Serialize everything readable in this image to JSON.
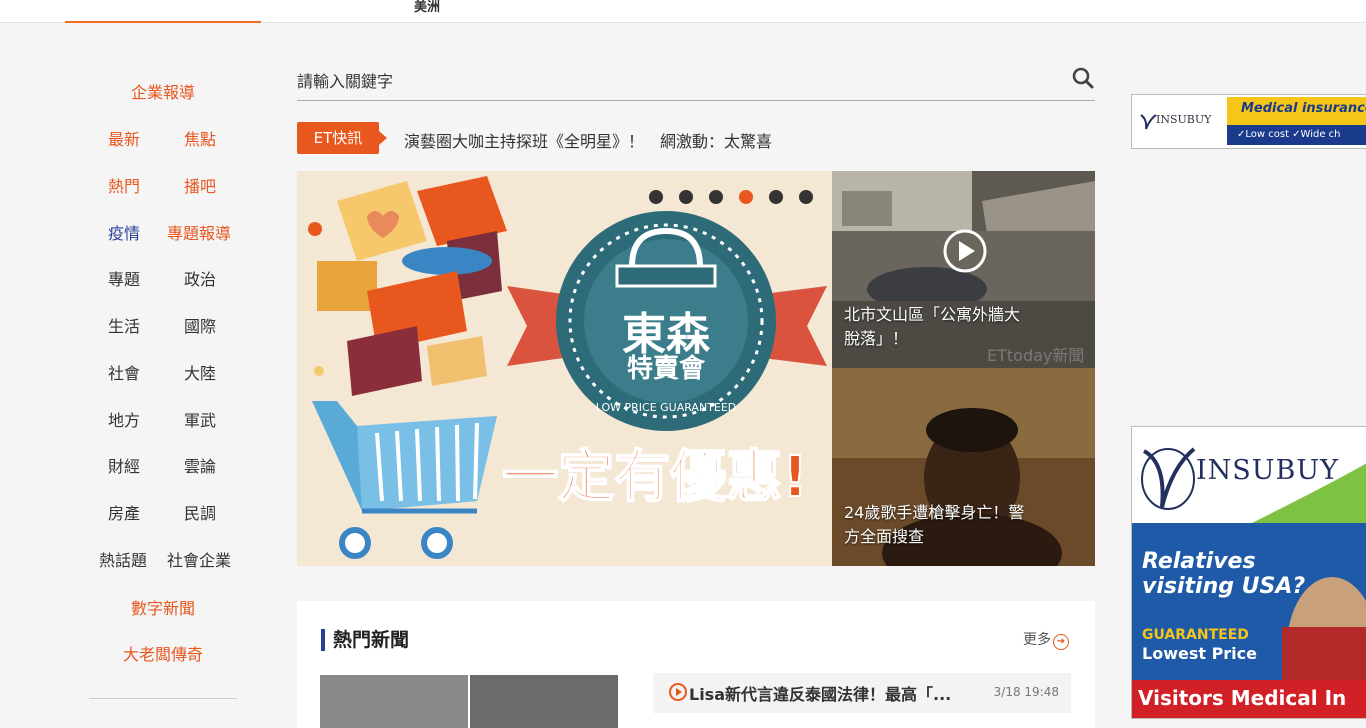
{
  "topbar": {
    "region": "美洲"
  },
  "sidebar": {
    "enterprise": "企業報導",
    "rows": [
      [
        "最新",
        "焦點"
      ],
      [
        "熱門",
        "播吧"
      ],
      [
        "疫情",
        "專題報導"
      ],
      [
        "專題",
        "政治"
      ],
      [
        "生活",
        "國際"
      ],
      [
        "社會",
        "大陸"
      ],
      [
        "地方",
        "軍武"
      ],
      [
        "財經",
        "雲論"
      ],
      [
        "房產",
        "民調"
      ],
      [
        "熱話題",
        "社會企業"
      ]
    ],
    "digital": "數字新聞",
    "boss": "大老闆傳奇"
  },
  "search": {
    "placeholder": "請輸入關鍵字",
    "icon": "search-icon"
  },
  "flash": {
    "tag": "ET快訊",
    "headline": "演藝圈大咖主持探班《全明星》！　網激動：太驚喜"
  },
  "banner": {
    "sign_line1": "東森",
    "sign_line2": "特賣會",
    "arc_text": "LOW PRICE GUARANTEED",
    "slogan": "一定有優惠!",
    "active_dot": 3
  },
  "side_stories": [
    {
      "caption_1": "北市文山區「公寓外牆大",
      "caption_2": "脫落」！",
      "watermark": "ETtoday新聞"
    },
    {
      "caption_1": "24歲歌手遭槍擊身亡！警",
      "caption_2": "方全面搜查"
    }
  ],
  "hot_news": {
    "title": "熱門新聞",
    "more": "更多",
    "item": {
      "text": "Lisa新代言違反泰國法律！最高「...",
      "time": "3/18 19:48"
    }
  },
  "ads": {
    "top": {
      "brand": "INSUBUY",
      "headline": "Medical insurance f",
      "features": "✓Low cost ✓Wide ch"
    },
    "side": {
      "brand": "INSUBUY",
      "line1": "Relatives",
      "line2": "visiting USA?",
      "guaranteed": "GUARANTEED",
      "lowest": "Lowest Price",
      "bottom": "Visitors Medical In"
    }
  }
}
